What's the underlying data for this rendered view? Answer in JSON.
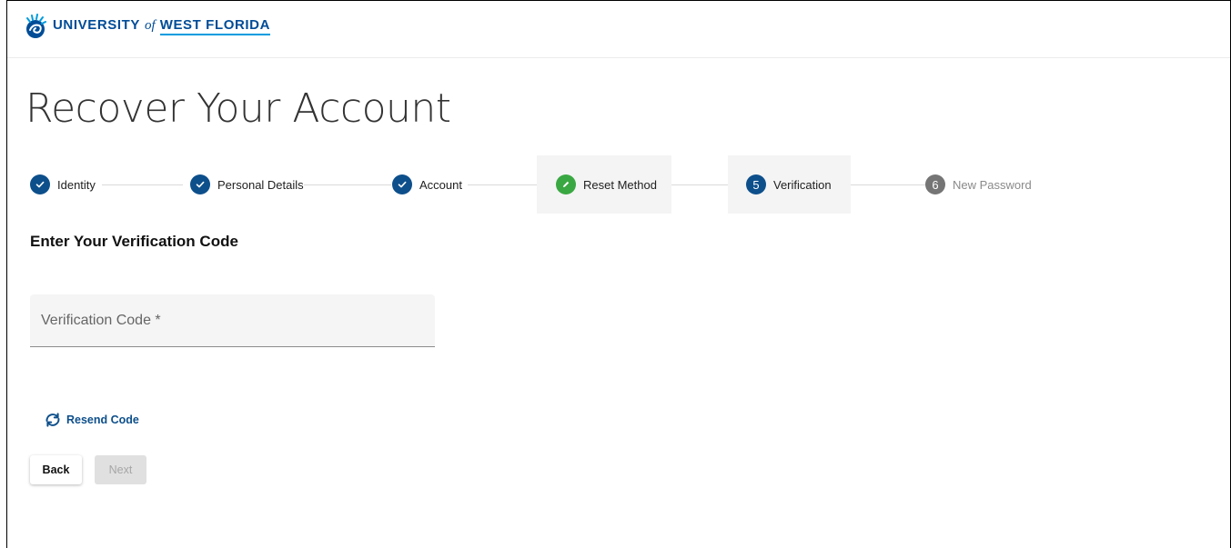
{
  "header": {
    "logo": {
      "university": "UNIVERSITY",
      "of": "of",
      "west_florida": "WEST FLORIDA"
    }
  },
  "page": {
    "title": "Recover Your Account"
  },
  "stepper": {
    "steps": [
      {
        "label": "Identity",
        "state": "done",
        "icon": "check-icon"
      },
      {
        "label": "Personal Details",
        "state": "done",
        "icon": "check-icon"
      },
      {
        "label": "Account",
        "state": "done",
        "icon": "check-icon"
      },
      {
        "label": "Reset Method",
        "state": "edit",
        "icon": "pencil-icon"
      },
      {
        "label": "Verification",
        "state": "current",
        "number": "5"
      },
      {
        "label": "New Password",
        "state": "pending",
        "number": "6"
      }
    ]
  },
  "form": {
    "section_title": "Enter Your Verification Code",
    "code_field": {
      "placeholder": "Verification Code *",
      "value": ""
    },
    "resend_label": "Resend Code",
    "back_label": "Back",
    "next_label": "Next"
  },
  "colors": {
    "brand_blue": "#004c97",
    "step_done": "#0d4f8b",
    "step_edit": "#3aa842",
    "step_pending": "#757575",
    "logo_accent": "#009cde"
  }
}
